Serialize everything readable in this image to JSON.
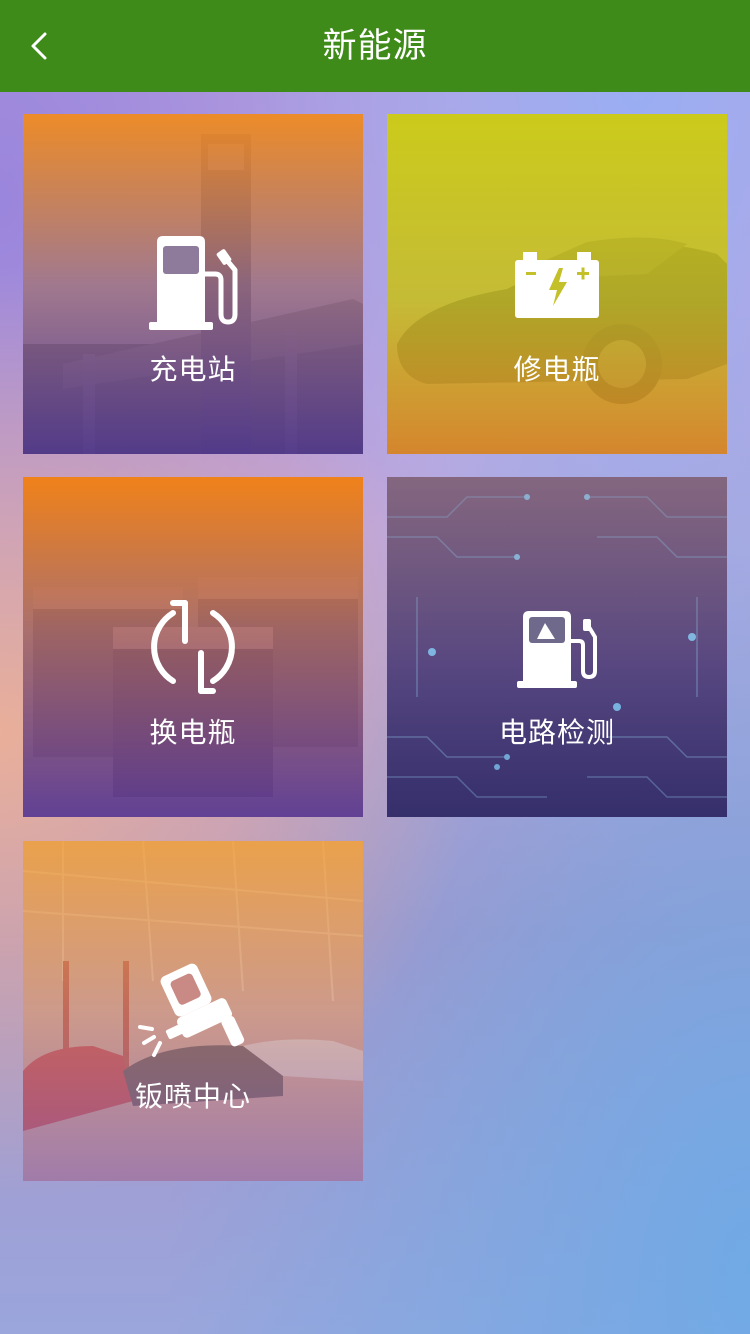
{
  "header": {
    "title": "新能源",
    "bg_color": "#3e8b1a"
  },
  "tiles": [
    {
      "label": "充电站",
      "icon": "fuel-pump-icon"
    },
    {
      "label": "修电瓶",
      "icon": "battery-icon"
    },
    {
      "label": "换电瓶",
      "icon": "swap-cycle-icon"
    },
    {
      "label": "电路检测",
      "icon": "charging-pile-icon"
    },
    {
      "label": "钣喷中心",
      "icon": "spray-gun-icon"
    }
  ]
}
